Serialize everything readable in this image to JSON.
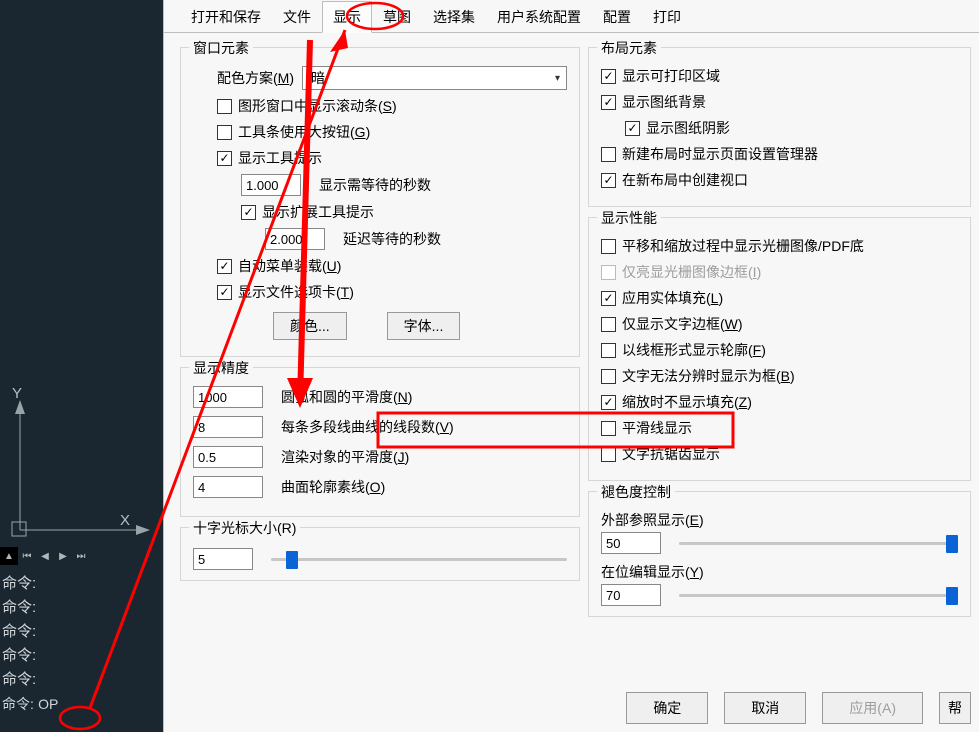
{
  "tabs": [
    "打开和保存",
    "文件",
    "显示",
    "草图",
    "选择集",
    "用户系统配置",
    "配置",
    "打印"
  ],
  "active_tab_index": 2,
  "cmd_prompt": "命令:",
  "cmd_value": "OP",
  "window_elements": {
    "title": "窗口元素",
    "color_scheme_label": "配色方案(",
    "color_scheme_key": "M",
    "color_scheme_value": "暗",
    "scrollbar_label_pre": "图形窗口中显示滚动条(",
    "scrollbar_key": "S",
    "largebtn_label_pre": "工具条使用大按钮(",
    "largebtn_key": "G",
    "tooltips_label": "显示工具提示",
    "tooltips_delay_value": "1.000",
    "tooltips_delay_label": "显示需等待的秒数",
    "ext_tooltips_label": "显示扩展工具提示",
    "ext_tooltips_value": "2.000",
    "ext_tooltips_delay_label": "延迟等待的秒数",
    "automenu_label_pre": "自动菜单装载(",
    "automenu_key": "U",
    "filetabs_label_pre": "显示文件选项卡(",
    "filetabs_key": "T",
    "color_btn": "颜色...",
    "font_btn": "字体..."
  },
  "precision": {
    "title": "显示精度",
    "arc_value": "1000",
    "arc_label_pre": "圆弧和圆的平滑度(",
    "arc_key": "N",
    "seg_value": "8",
    "seg_label_pre": "每条多段线曲线的线段数(",
    "seg_key": "V",
    "render_value": "0.5",
    "render_label_pre": "渲染对象的平滑度(",
    "render_key": "J",
    "surf_value": "4",
    "surf_label_pre": "曲面轮廓素线(",
    "surf_key": "O"
  },
  "crosshair": {
    "title_pre": "十字光标大小(",
    "title_key": "R",
    "value": "5",
    "slider_pct": 5
  },
  "layout": {
    "title": "布局元素",
    "printable": "显示可打印区域",
    "paper_bg": "显示图纸背景",
    "paper_shadow": "显示图纸阴影",
    "pagesetup": "新建布局时显示页面设置管理器",
    "viewport": "在新布局中创建视口"
  },
  "perf": {
    "title": "显示性能",
    "pan": "平移和缩放过程中显示光栅图像/PDF底",
    "highlight_pre": "仅亮显光栅图像边框(",
    "highlight_key": "I",
    "solidfill_pre": "应用实体填充(",
    "solidfill_key": "L",
    "textframe_pre": "仅显示文字边框(",
    "textframe_key": "W",
    "wireframe_pre": "以线框形式显示轮廓(",
    "wireframe_key": "F",
    "textbox_pre": "文字无法分辨时显示为框(",
    "textbox_key": "B",
    "zoomfill_pre": "缩放时不显示填充(",
    "zoomfill_key": "Z",
    "smoothline": "平滑线显示",
    "antialias": "文字抗锯齿显示"
  },
  "fade": {
    "title": "褪色度控制",
    "xref_label_pre": "外部参照显示(",
    "xref_key": "E",
    "xref_value": "50",
    "xref_pct": 100,
    "inplace_label_pre": "在位编辑显示(",
    "inplace_key": "Y",
    "inplace_value": "70",
    "inplace_pct": 100
  },
  "footer": {
    "ok": "确定",
    "cancel": "取消",
    "apply_pre": "应用(",
    "apply_key": "A",
    "help": "帮"
  }
}
